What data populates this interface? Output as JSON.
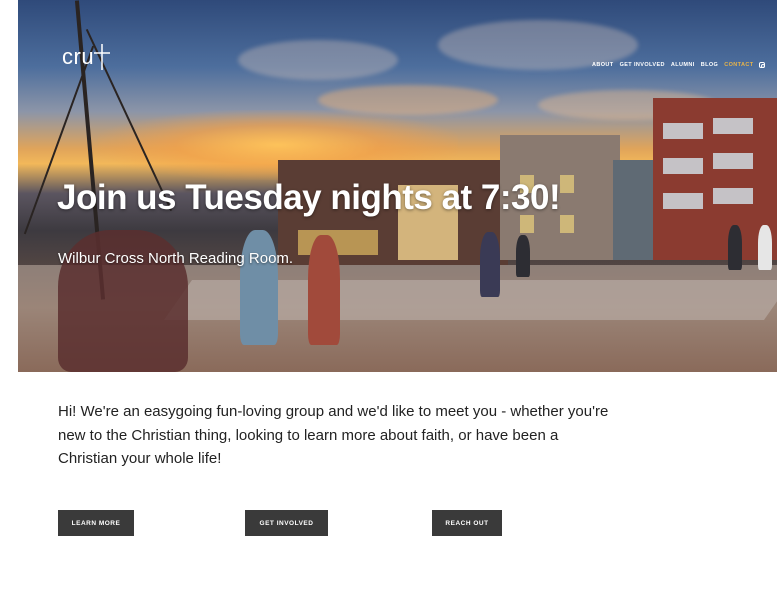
{
  "brand": {
    "logo_text": "cru"
  },
  "nav": {
    "items": [
      {
        "label": "About"
      },
      {
        "label": "Get Involved"
      },
      {
        "label": "Alumni"
      },
      {
        "label": "Blog"
      },
      {
        "label": "Contact",
        "active": true
      }
    ],
    "accent_color": "#e8b44a",
    "social_icon": "instagram-icon"
  },
  "hero": {
    "title": "Join us Tuesday nights at 7:30!",
    "subtitle": "Wilbur Cross North Reading Room."
  },
  "intro": {
    "text": "Hi! We're an easygoing fun-loving group and we'd like to meet you - whether you're new to the Christian thing, looking to learn more about faith, or have been a Christian your whole life!"
  },
  "buttons": [
    {
      "label": "Learn More"
    },
    {
      "label": "Get Involved"
    },
    {
      "label": "Reach Out"
    }
  ],
  "colors": {
    "button_bg": "#3a3a3a",
    "text": "#222222"
  }
}
